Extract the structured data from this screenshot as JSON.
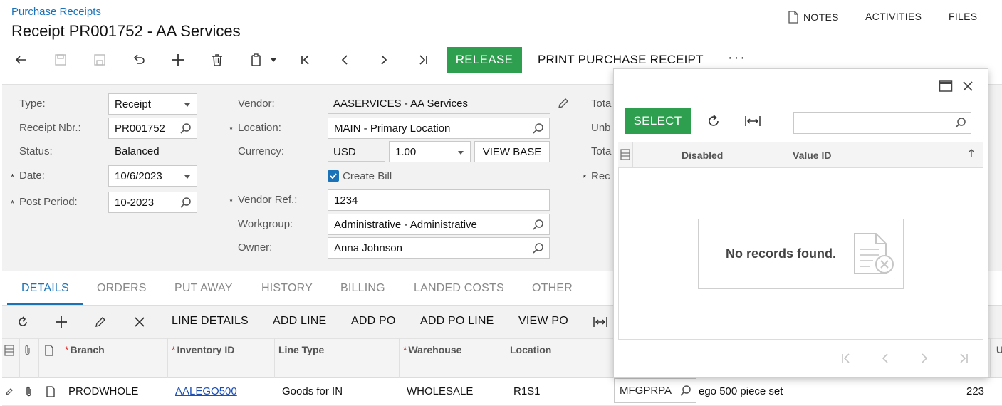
{
  "header": {
    "breadcrumb": "Purchase Receipts",
    "title": "Receipt PR001752 - AA Services",
    "links": {
      "notes": "NOTES",
      "activities": "ACTIVITIES",
      "files": "FILES"
    }
  },
  "toolbar": {
    "release": "RELEASE",
    "print": "PRINT PURCHASE RECEIPT",
    "more": "···"
  },
  "form": {
    "type_label": "Type:",
    "type_value": "Receipt",
    "receipt_nbr_label": "Receipt Nbr.:",
    "receipt_nbr_value": "PR001752",
    "status_label": "Status:",
    "status_value": "Balanced",
    "date_label": "Date:",
    "date_value": "10/6/2023",
    "post_period_label": "Post Period:",
    "post_period_value": "10-2023",
    "vendor_label": "Vendor:",
    "vendor_value": "AASERVICES - AA Services",
    "location_label": "Location:",
    "location_value": "MAIN - Primary Location",
    "currency_label": "Currency:",
    "currency_value": "USD",
    "rate_value": "1.00",
    "view_base": "VIEW BASE",
    "create_bill_label": "Create Bill",
    "vendor_ref_label": "Vendor Ref.:",
    "vendor_ref_value": "1234",
    "workgroup_label": "Workgroup:",
    "workgroup_value": "Administrative - Administrative",
    "owner_label": "Owner:",
    "owner_value": "Anna Johnson",
    "right_labels": [
      "Tota",
      "Unb",
      "Tota",
      "Rec"
    ],
    "required_mark": "*"
  },
  "tabs": [
    "DETAILS",
    "ORDERS",
    "PUT AWAY",
    "HISTORY",
    "BILLING",
    "LANDED COSTS",
    "OTHER"
  ],
  "grid_toolbar": [
    "LINE DETAILS",
    "ADD LINE",
    "ADD PO",
    "ADD PO LINE",
    "VIEW PO"
  ],
  "grid": {
    "columns": [
      "Branch",
      "Inventory ID",
      "Line Type",
      "Warehouse",
      "Location"
    ],
    "row": {
      "branch": "PRODWHOLE",
      "inventory_id": "AALEGO500",
      "line_type": "Goods for IN",
      "warehouse": "WHOLESALE",
      "location": "R1S1",
      "lot": "MFGPRPA",
      "description": "ego 500 piece set",
      "qty": "223",
      "extra_col_header": "U"
    }
  },
  "dialog": {
    "select": "SELECT",
    "columns": [
      "Disabled",
      "Value ID"
    ],
    "empty_message": "No records found."
  },
  "colors": {
    "accent": "#1a73b8",
    "action_green": "#2e9e4f"
  }
}
